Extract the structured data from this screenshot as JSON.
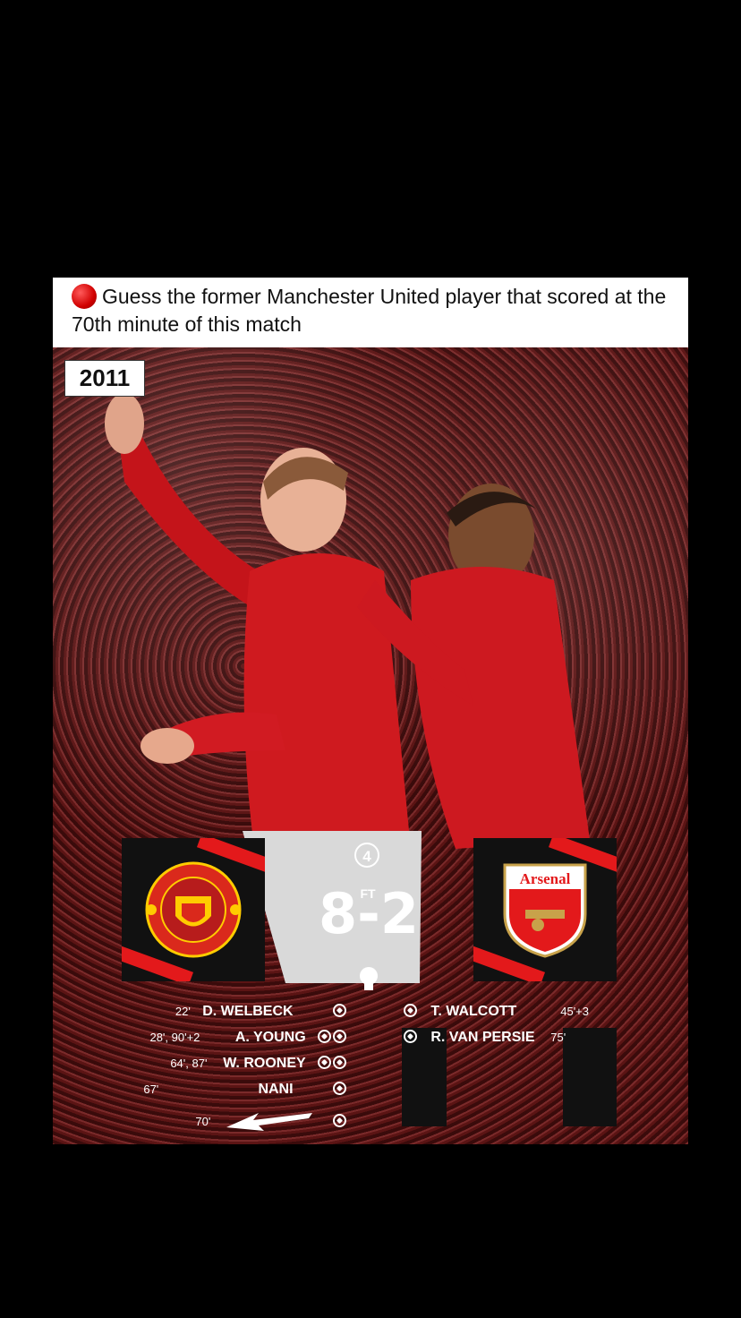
{
  "caption": {
    "text": "Guess the former Manchester United player that scored at the 70th minute of this match"
  },
  "graphic": {
    "year": "2011",
    "matchday": "4",
    "home_club": "MANCHESTER UNITED",
    "away_club": "Arsenal",
    "home_score": "8",
    "away_score": "2",
    "status": "FT",
    "home_scorers": [
      {
        "minutes": "22'",
        "name": "D. WELBECK",
        "goals": 1
      },
      {
        "minutes": "28', 90'+2",
        "name": "A. YOUNG",
        "goals": 2
      },
      {
        "minutes": "64', 87'",
        "name": "W. ROONEY",
        "goals": 2
      },
      {
        "minutes": "67'",
        "name": "NANI",
        "goals": 1
      },
      {
        "minutes": "70'",
        "name": "",
        "goals": 1
      }
    ],
    "away_scorers": [
      {
        "name": "T. WALCOTT",
        "minutes": "45'+3",
        "goals": 1
      },
      {
        "name": "R. VAN PERSIE",
        "minutes": "75'",
        "goals": 1
      }
    ],
    "colors": {
      "accent": "#e3191b",
      "caption_dot": "#d10000"
    }
  }
}
